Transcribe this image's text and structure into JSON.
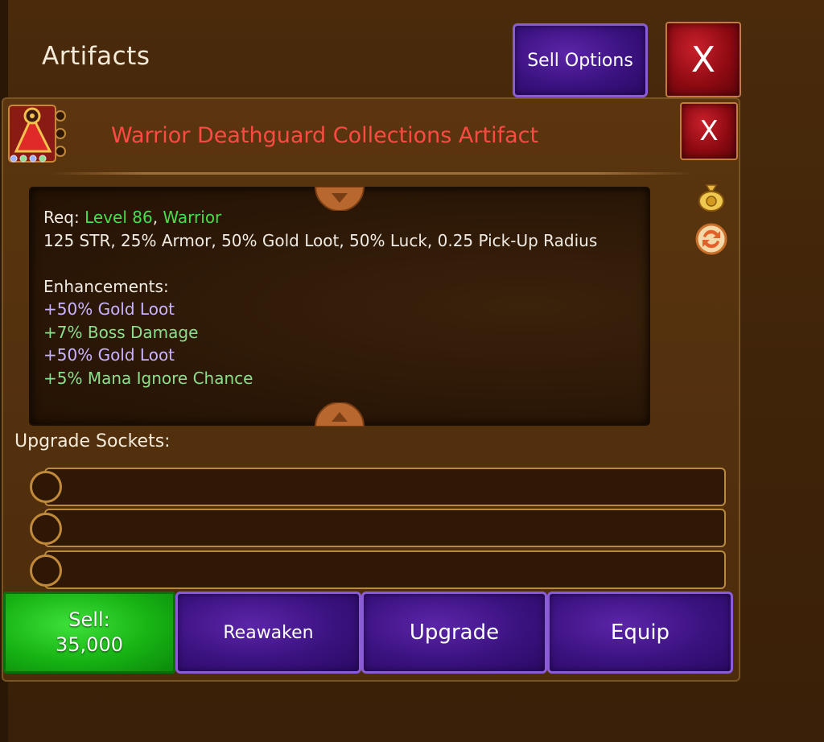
{
  "header": {
    "title": "Artifacts",
    "sell_options_label": "Sell Options",
    "close_label": "X"
  },
  "item": {
    "name": "Warrior Deathguard Collections Artifact",
    "close_label": "X",
    "req_prefix": "Req: ",
    "req_level": "Level 86",
    "req_sep": ", ",
    "req_class": "Warrior",
    "stats": "125 STR, 25% Armor, 50% Gold Loot, 50% Luck, 0.25 Pick-Up Radius",
    "enhancements_title": "Enhancements:",
    "enhancements": [
      "+50% Gold Loot",
      "+7% Boss Damage",
      "+50% Gold Loot",
      "+5% Mana Ignore Chance"
    ]
  },
  "sockets": {
    "label": "Upgrade Sockets:",
    "count": 3
  },
  "actions": {
    "sell_label": "Sell:",
    "sell_price": "35,000",
    "reawaken_label": "Reawaken",
    "upgrade_label": "Upgrade",
    "equip_label": "Equip"
  },
  "colors": {
    "background": "#3d2208",
    "item_name": "#ff4a44",
    "req_green": "#44e04a",
    "enh_lavender": "#c8b4ff",
    "enh_green": "#8ce08c",
    "sell_green": "#17b314",
    "button_purple": "#3b1280"
  },
  "icons": [
    "artifact-icon",
    "gold-bag-icon",
    "swap-icon",
    "scroll-up-arrow-icon",
    "scroll-down-arrow-icon"
  ]
}
